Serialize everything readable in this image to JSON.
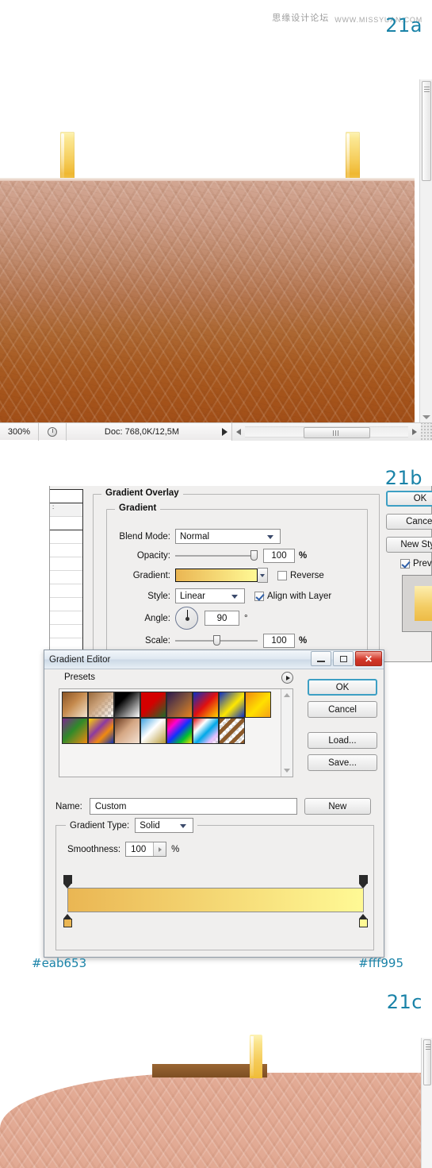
{
  "watermark": {
    "cn_text": "思缘设计论坛",
    "url_text": "WWW.MISSYUAN.COM"
  },
  "steps": {
    "a": "21a",
    "b": "21b",
    "c": "21c"
  },
  "photoshop_status_bar": {
    "zoom": "300%",
    "doc_info": "Doc: 768,0K/12,5M",
    "clock_icon": "clock-icon",
    "play_icon": "play-triangle-icon",
    "left_arrow_icon": "left-arrow-icon",
    "right_arrow_icon": "right-arrow-icon",
    "resize_grip_icon": "resize-grip-icon"
  },
  "layer_style": {
    "section_title": "Gradient Overlay",
    "group_title": "Gradient",
    "fields": {
      "blend_mode_label": "Blend Mode:",
      "blend_mode_value": "Normal",
      "opacity_label": "Opacity:",
      "opacity_value": "100",
      "opacity_unit": "%",
      "gradient_label": "Gradient:",
      "reverse_label": "Reverse",
      "reverse_checked": false,
      "style_label": "Style:",
      "style_value": "Linear",
      "align_label": "Align with Layer",
      "align_checked": true,
      "angle_label": "Angle:",
      "angle_value": "90",
      "angle_unit": "°",
      "scale_label": "Scale:",
      "scale_value": "100",
      "scale_unit": "%"
    },
    "buttons": {
      "ok": "OK",
      "cancel": "Cancel",
      "new_style": "New Style...",
      "preview_label": "Preview",
      "preview_checked": true
    }
  },
  "gradient_editor": {
    "title": "Gradient Editor",
    "window_buttons": {
      "minimize": "minimize-icon",
      "maximize": "maximize-icon",
      "close": "✕"
    },
    "presets": {
      "legend": "Presets",
      "menu_icon": "preset-menu-arrow-icon",
      "swatches": [
        {
          "name": "foreground-to-background",
          "css": "linear-gradient(135deg,#8a5426,#c58a4d 45%,#f2e3cf)"
        },
        {
          "name": "foreground-to-transparent",
          "css": "linear-gradient(135deg,#9a6a3c,#c9a078 40%,rgba(255,255,255,0)), repeating-conic-gradient(#ffffff 0% 25%,#cccccc 0% 50%) 0 0/8px 8px"
        },
        {
          "name": "black-white",
          "css": "linear-gradient(135deg,#000000,#000000 30%,#ffffff)"
        },
        {
          "name": "red-green",
          "css": "linear-gradient(135deg,#d40000,#d40000 45%,#1e6b28)"
        },
        {
          "name": "violet-orange",
          "css": "linear-gradient(135deg,#2d1b4e,#8c5a3a 55%,#e8821d)"
        },
        {
          "name": "blue-red-yellow",
          "css": "linear-gradient(135deg,#0b2fc4,#e01010 50%,#ffd400)"
        },
        {
          "name": "blue-yellow-blue",
          "css": "linear-gradient(135deg,#0b2fc4,#ffe800 55%,#0b2fc4)"
        },
        {
          "name": "orange-yellow-orange",
          "css": "linear-gradient(135deg,#f08a10,#ffe000 55%,#f5a017)"
        },
        {
          "name": "violet-green-orange",
          "css": "linear-gradient(135deg,#7a2a8c,#2f8a2a 45%,#f08a10)"
        },
        {
          "name": "yellow-violet-orange-blue",
          "css": "linear-gradient(135deg,#ffd400,#8c3aa0 40%,#f08a10 65%,#1030b0)"
        },
        {
          "name": "copper",
          "css": "linear-gradient(135deg,#6b3a1e,#d5a784 45%,#f3e1d2)"
        },
        {
          "name": "chrome",
          "css": "linear-gradient(135deg,#3fa2e0,#ffffff 45%,#b89a38)"
        },
        {
          "name": "spectrum",
          "css": "linear-gradient(135deg,#e01010,#ff00d0 25%,#1030ff 50%,#00c030 75%,#ffe000)"
        },
        {
          "name": "transparent-rainbow",
          "css": "linear-gradient(135deg,#e01010,#ffffff 30%,#00a8e8 55%,#e8c0ff 80%,rgba(255,255,255,0)), repeating-conic-gradient(#ffffff 0% 25%,#cccccc 0% 50%) 0 0/8px 8px"
        },
        {
          "name": "transparent-stripes",
          "css": "repeating-linear-gradient(135deg,#8c5a2a 0 5px,rgba(255,255,255,0) 5px 10px), repeating-conic-gradient(#ffffff 0% 25%,#dcdcdc 0% 50%) 0 0/8px 8px"
        }
      ]
    },
    "buttons": {
      "ok": "OK",
      "cancel": "Cancel",
      "load": "Load...",
      "save": "Save..."
    },
    "name_label": "Name:",
    "name_value": "Custom",
    "new_button": "New",
    "gradient_type_label": "Gradient Type:",
    "gradient_type_value": "Solid",
    "smoothness_label": "Smoothness:",
    "smoothness_value": "100",
    "smoothness_unit": "%",
    "gradient_bar": {
      "left_color": "#eab653",
      "right_color": "#fff995",
      "opacity_stops": [
        "opacity-stop-left",
        "opacity-stop-right"
      ],
      "color_stops": [
        "color-stop-left",
        "color-stop-right"
      ]
    }
  },
  "hex_labels": {
    "left": "#eab653",
    "right": "#fff995"
  },
  "artwork": {
    "leather_top": "#d2a692",
    "leather_bottom": "#a24f18",
    "clip_color": "#f5cb58",
    "board_color": "#8a5a2a",
    "soft_leather": "#e2aa94"
  }
}
